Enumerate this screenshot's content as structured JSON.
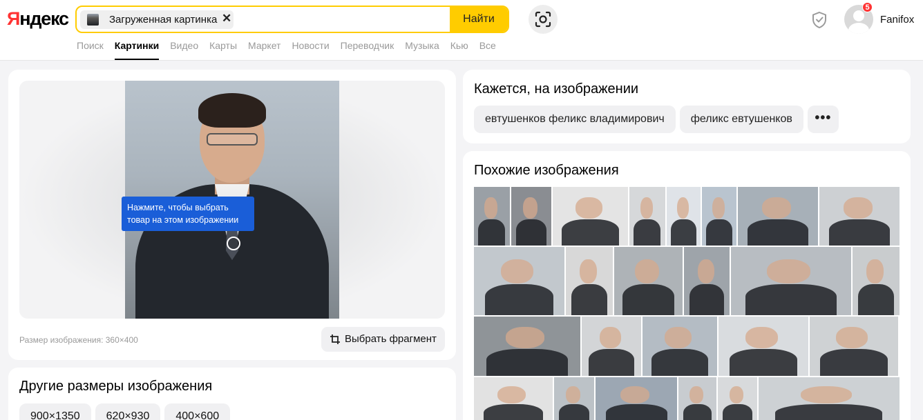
{
  "header": {
    "logo": {
      "main": "Яндекс",
      "first_letter": "Я",
      "rest": "ндекс"
    },
    "search": {
      "chip_label": "Загруженная картинка",
      "clear_symbol": "✕",
      "button_label": "Найти"
    },
    "user": {
      "name": "Fanifox",
      "notifications": "5"
    },
    "nav": [
      {
        "label": "Поиск",
        "active": false
      },
      {
        "label": "Картинки",
        "active": true
      },
      {
        "label": "Видео",
        "active": false
      },
      {
        "label": "Карты",
        "active": false
      },
      {
        "label": "Маркет",
        "active": false
      },
      {
        "label": "Новости",
        "active": false
      },
      {
        "label": "Переводчик",
        "active": false
      },
      {
        "label": "Музыка",
        "active": false
      },
      {
        "label": "Кью",
        "active": false
      },
      {
        "label": "Все",
        "active": false
      }
    ],
    "colors": {
      "accent": "#ffcc00",
      "logo_red": "#ff3333",
      "badge": "#ff3333"
    },
    "icons": [
      "lens-icon",
      "shield-icon",
      "user-avatar-icon"
    ]
  },
  "main_image": {
    "tooltip": "Нажмите, чтобы выбрать товар на этом изображении",
    "size_label": "Размер изображения: 360×400",
    "select_fragment_label": "Выбрать фрагмент",
    "tooltip_color": "#1a5ed8"
  },
  "other_sizes": {
    "title": "Другие размеры изображения",
    "sizes": [
      "900×1350",
      "620×930",
      "400×600"
    ]
  },
  "recognition": {
    "title": "Кажется, на изображении",
    "tags": [
      "евтушенков феликс владимирович",
      "феликс евтушенков"
    ],
    "more_label": "•••"
  },
  "similar": {
    "title": "Похожие изображения"
  }
}
